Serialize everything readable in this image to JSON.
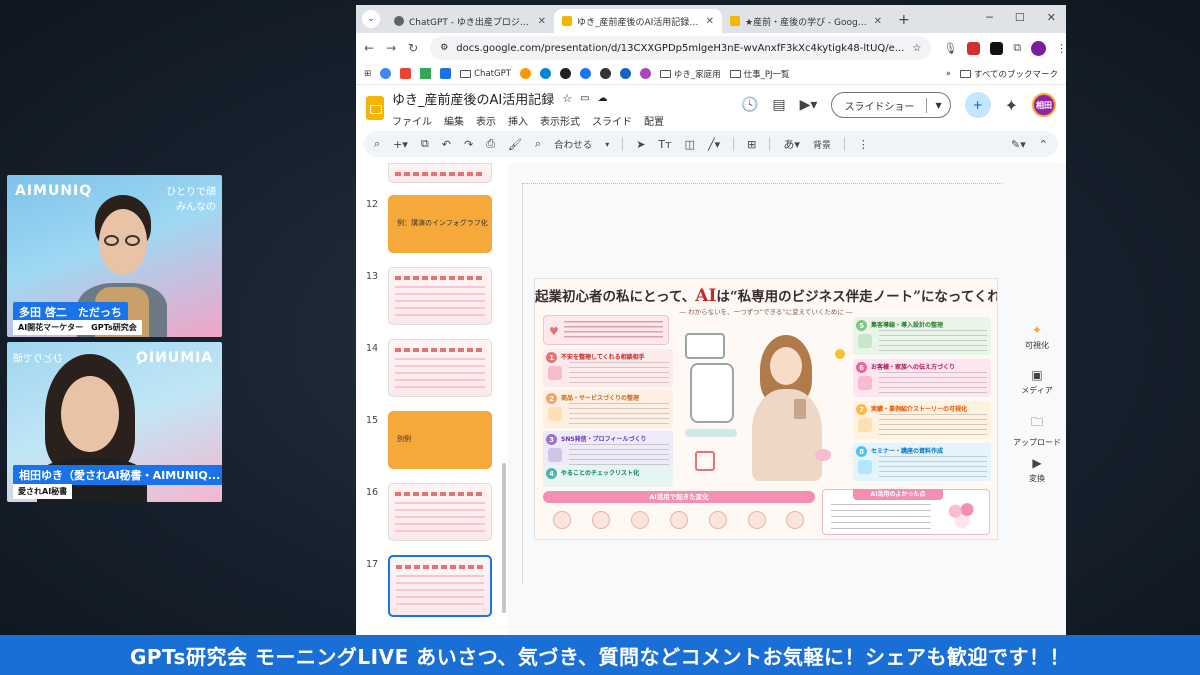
{
  "browser": {
    "tabs": [
      {
        "title": "ChatGPT - ゆき出産プロジェクト",
        "active": false,
        "color": "#5f6368"
      },
      {
        "title": "ゆき_産前産後のAI活用記録 - Goo",
        "active": true,
        "color": "#f4b400"
      },
      {
        "title": "★産前・産後の学び - Google ス",
        "active": false,
        "color": "#f4b400"
      }
    ],
    "url": "docs.google.com/presentation/d/13CXXGPDp5mlgeH3nE-wvAnxfF3kXc4kytigk48-ltUQ/e...",
    "bookmarks": [
      {
        "label": "ChatGPT",
        "type": "folder"
      },
      {
        "label": "ゆき_家庭用",
        "type": "folder"
      },
      {
        "label": "仕事_PJ一覧",
        "type": "folder"
      }
    ],
    "all_bookmarks": "すべてのブックマーク"
  },
  "slides_app": {
    "doc_title": "ゆき_産前産後のAI活用記録",
    "menus": [
      "ファイル",
      "編集",
      "表示",
      "挿入",
      "表示形式",
      "スライド",
      "配置"
    ],
    "slideshow_label": "スライドショー",
    "user_initials": "相田",
    "toolbar": {
      "zoom": "合わせる",
      "background": "背景"
    }
  },
  "filmstrip": [
    {
      "num": "12",
      "kind": "orange",
      "label": "例：講演のインフォグラフ化"
    },
    {
      "num": "13",
      "kind": "info",
      "label": ""
    },
    {
      "num": "14",
      "kind": "info",
      "label": ""
    },
    {
      "num": "15",
      "kind": "orange",
      "label": "別例"
    },
    {
      "num": "16",
      "kind": "info",
      "label": ""
    },
    {
      "num": "17",
      "kind": "info",
      "label": ""
    }
  ],
  "slide": {
    "title_pre": "起業初心者の私にとって、",
    "title_ai": "AI",
    "title_post": "は“私専用のビジネス伴走ノート”になってくれた",
    "subtitle": "― わからないを、一つずつ“できる”に変えていくために ―",
    "cards": [
      {
        "num": "1",
        "title": "不安を整理してくれる相談相手",
        "color": "#e57373"
      },
      {
        "num": "2",
        "title": "商品・サービスづくりの整理",
        "color": "#f4a261"
      },
      {
        "num": "3",
        "title": "SNS発信・プロフィールづくり",
        "color": "#9575cd"
      },
      {
        "num": "4",
        "title": "やることのチェックリスト化",
        "color": "#4db6ac"
      },
      {
        "num": "5",
        "title": "集客導線・導入設計の整理",
        "color": "#81c784"
      },
      {
        "num": "6",
        "title": "お客様・家族への伝え方づくり",
        "color": "#f06292"
      },
      {
        "num": "7",
        "title": "実績・事例紹介ストーリーの可視化",
        "color": "#ffb74d"
      },
      {
        "num": "8",
        "title": "セミナー・講座の資料作成",
        "color": "#4fc3f7"
      }
    ],
    "flow_title": "AI活用で起きた変化",
    "merit_title": "AI活用のよかった点"
  },
  "side_panel": [
    "可視化",
    "メディア",
    "アップロード",
    "変換"
  ],
  "cam1": {
    "logo": "AIMUNIQ",
    "tag_line1": "ひとりで頑",
    "tag_line2": "みんなの",
    "name": "多田 啓二　ただっち",
    "role": "AI開花マーケター　GPTs研究会"
  },
  "cam2": {
    "logo": "AIMUNIQ",
    "tag_line1": "ひとりで頑",
    "name": "相田ゆき（愛されAI秘書・AIMUNIQ...",
    "role": "愛されAI秘書"
  },
  "banner": "GPTs研究会 モーニングLIVE あいさつ、気づき、質問などコメントお気軽に！シェアも歓迎です！！"
}
